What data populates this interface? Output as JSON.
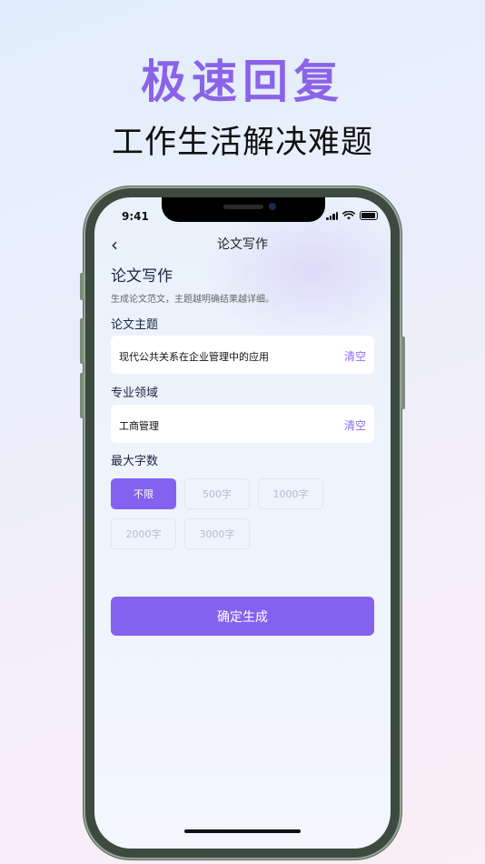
{
  "hero": {
    "title": "极速回复",
    "subtitle": "工作生活解决难题"
  },
  "status": {
    "time": "9:41"
  },
  "nav": {
    "title": "论文写作"
  },
  "page": {
    "heading": "论文写作",
    "description": "生成论文范文，主题越明确结果越详细。"
  },
  "topic": {
    "label": "论文主题",
    "value": "现代公共关系在企业管理中的应用",
    "clear_label": "清空"
  },
  "field": {
    "label": "专业领域",
    "value": "工商管理",
    "clear_label": "清空"
  },
  "word_limit": {
    "label": "最大字数",
    "options": [
      "不限",
      "500字",
      "1000字",
      "2000字",
      "3000字"
    ],
    "selected": "不限"
  },
  "confirm": {
    "label": "确定生成"
  },
  "colors": {
    "accent": "#8462ef",
    "hero_title": "#8b63e8"
  }
}
